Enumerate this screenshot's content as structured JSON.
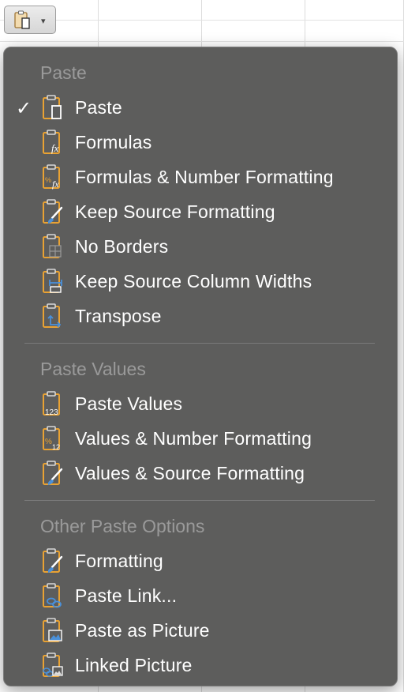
{
  "toolbar": {
    "paste_options_icon": "clipboard-icon",
    "caret_glyph": "▾"
  },
  "menu": {
    "sections": [
      {
        "header": "Paste",
        "items": [
          {
            "label": "Paste",
            "icon": "paste-icon",
            "checked": true
          },
          {
            "label": "Formulas",
            "icon": "paste-formulas-icon"
          },
          {
            "label": "Formulas & Number Formatting",
            "icon": "paste-formulas-number-formatting-icon"
          },
          {
            "label": "Keep Source Formatting",
            "icon": "paste-keep-source-formatting-icon"
          },
          {
            "label": "No Borders",
            "icon": "paste-no-borders-icon"
          },
          {
            "label": "Keep Source Column Widths",
            "icon": "paste-column-widths-icon"
          },
          {
            "label": "Transpose",
            "icon": "paste-transpose-icon"
          }
        ]
      },
      {
        "header": "Paste Values",
        "items": [
          {
            "label": "Paste Values",
            "icon": "paste-values-icon"
          },
          {
            "label": "Values & Number Formatting",
            "icon": "paste-values-number-formatting-icon"
          },
          {
            "label": "Values & Source Formatting",
            "icon": "paste-values-source-formatting-icon"
          }
        ]
      },
      {
        "header": "Other Paste Options",
        "items": [
          {
            "label": "Formatting",
            "icon": "paste-formatting-icon"
          },
          {
            "label": "Paste Link...",
            "icon": "paste-link-icon"
          },
          {
            "label": "Paste as Picture",
            "icon": "paste-picture-icon"
          },
          {
            "label": "Linked Picture",
            "icon": "linked-picture-icon"
          }
        ]
      }
    ],
    "check_glyph": "✓"
  },
  "colors": {
    "menu_bg": "#5d5d5c",
    "header_text": "#9a9a9a",
    "clipboard_orange": "#e9a233",
    "accent_blue": "#4a90d9"
  }
}
